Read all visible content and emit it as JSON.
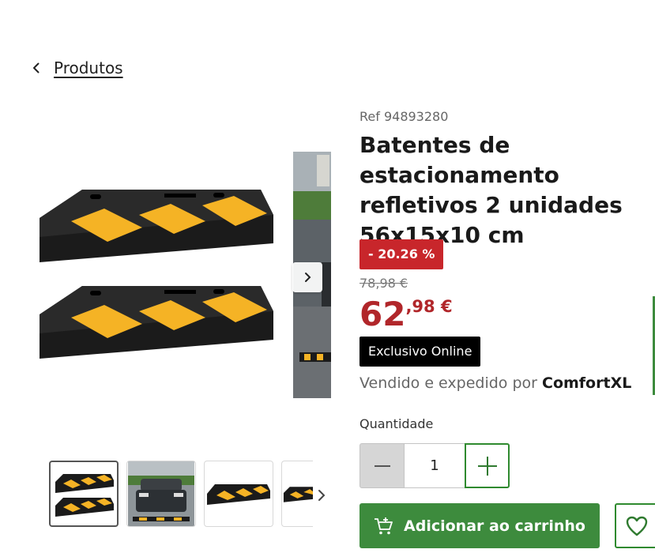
{
  "breadcrumb": {
    "label": "Produtos",
    "icon": "chevron-left-icon"
  },
  "product": {
    "ref": "Ref 94893280",
    "title": "Batentes de estacionamento refletivos 2 unidades 56x15x10 cm",
    "discount": "- 20.26 %",
    "old_price": "78,98 €",
    "price_int": "62",
    "price_dec": ",98 €",
    "online_badge": "Exclusivo Online",
    "seller_prefix": "Vendido e expedido por ",
    "seller_name": "ComfortXL"
  },
  "quantity": {
    "label": "Quantidade",
    "value": "1"
  },
  "actions": {
    "add_to_cart": "Adicionar ao carrinho"
  },
  "colors": {
    "price_red": "#b1262a",
    "discount_red": "#c8262b",
    "brand_green": "#3d8b3d",
    "reflector_yellow": "#f5b325"
  },
  "gallery": {
    "thumbnails": [
      "image-1",
      "image-2",
      "image-3",
      "image-4"
    ],
    "active_index": 0
  }
}
